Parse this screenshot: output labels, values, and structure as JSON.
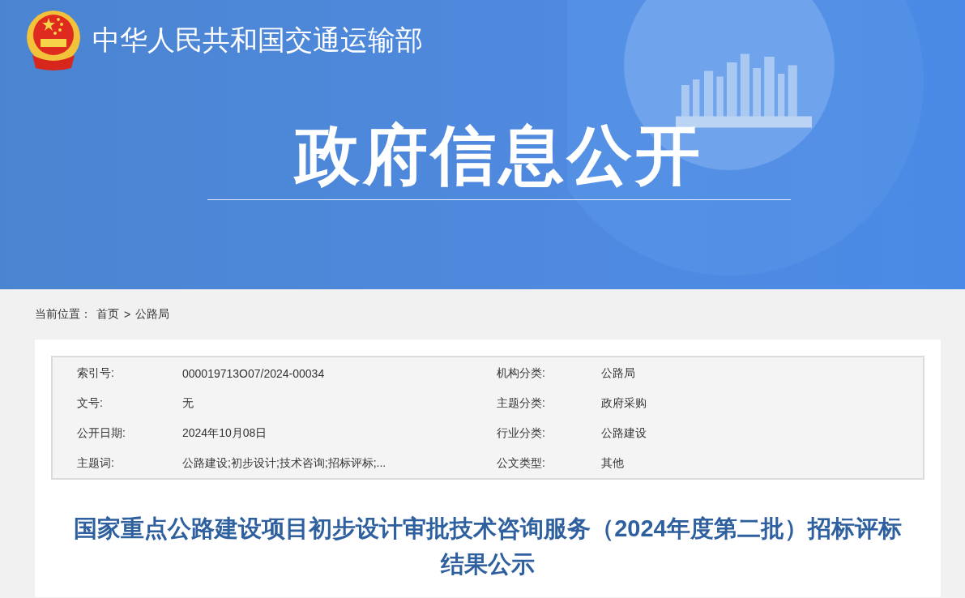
{
  "header": {
    "ministry_name": "中华人民共和国交通运输部",
    "banner_title": "政府信息公开"
  },
  "breadcrumb": {
    "label": "当前位置：",
    "items": [
      {
        "text": "首页"
      },
      {
        "text": "公路局"
      }
    ],
    "separator": ">"
  },
  "info_table": [
    {
      "label": "索引号:",
      "value": "000019713O07/2024-00034"
    },
    {
      "label": "机构分类:",
      "value": "公路局"
    },
    {
      "label": "文号:",
      "value": "无"
    },
    {
      "label": "主题分类:",
      "value": "政府采购"
    },
    {
      "label": "公开日期:",
      "value": "2024年10月08日"
    },
    {
      "label": "行业分类:",
      "value": "公路建设"
    },
    {
      "label": "主题词:",
      "value": "公路建设;初步设计;技术咨询;招标评标;..."
    },
    {
      "label": "公文类型:",
      "value": "其他"
    }
  ],
  "article": {
    "title": "国家重点公路建设项目初步设计审批技术咨询服务（2024年度第二批）招标评标结果公示"
  }
}
